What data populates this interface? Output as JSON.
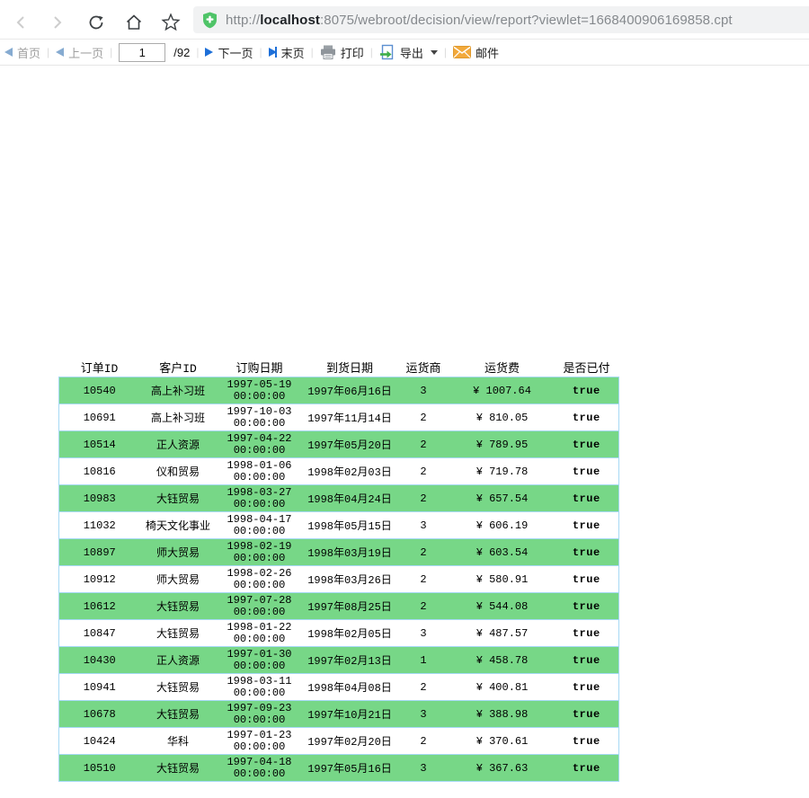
{
  "browser": {
    "url_scheme": "http://",
    "url_host": "localhost",
    "url_rest": ":8075/webroot/decision/view/report?viewlet=1668400906169858.cpt"
  },
  "toolbar": {
    "first_label": "首页",
    "prev_label": "上一页",
    "page_value": "1",
    "page_total": "/92",
    "next_label": "下一页",
    "last_label": "末页",
    "print_label": "打印",
    "export_label": "导出",
    "mail_label": "邮件"
  },
  "table": {
    "headers": [
      "订单ID",
      "客户ID",
      "订购日期",
      "到货日期",
      "运货商",
      "运货费",
      "是否已付"
    ],
    "rows": [
      {
        "order_id": "10540",
        "customer": "高上补习班",
        "order_date": "1997-05-19",
        "order_time": "00:00:00",
        "arrival_date": "1997年06月16日",
        "shipper": "3",
        "freight": "¥ 1007.64",
        "paid": "true"
      },
      {
        "order_id": "10691",
        "customer": "高上补习班",
        "order_date": "1997-10-03",
        "order_time": "00:00:00",
        "arrival_date": "1997年11月14日",
        "shipper": "2",
        "freight": "¥ 810.05",
        "paid": "true"
      },
      {
        "order_id": "10514",
        "customer": "正人资源",
        "order_date": "1997-04-22",
        "order_time": "00:00:00",
        "arrival_date": "1997年05月20日",
        "shipper": "2",
        "freight": "¥ 789.95",
        "paid": "true"
      },
      {
        "order_id": "10816",
        "customer": "仪和贸易",
        "order_date": "1998-01-06",
        "order_time": "00:00:00",
        "arrival_date": "1998年02月03日",
        "shipper": "2",
        "freight": "¥ 719.78",
        "paid": "true"
      },
      {
        "order_id": "10983",
        "customer": "大钰贸易",
        "order_date": "1998-03-27",
        "order_time": "00:00:00",
        "arrival_date": "1998年04月24日",
        "shipper": "2",
        "freight": "¥ 657.54",
        "paid": "true"
      },
      {
        "order_id": "11032",
        "customer": "椅天文化事业",
        "order_date": "1998-04-17",
        "order_time": "00:00:00",
        "arrival_date": "1998年05月15日",
        "shipper": "3",
        "freight": "¥ 606.19",
        "paid": "true"
      },
      {
        "order_id": "10897",
        "customer": "师大贸易",
        "order_date": "1998-02-19",
        "order_time": "00:00:00",
        "arrival_date": "1998年03月19日",
        "shipper": "2",
        "freight": "¥ 603.54",
        "paid": "true"
      },
      {
        "order_id": "10912",
        "customer": "师大贸易",
        "order_date": "1998-02-26",
        "order_time": "00:00:00",
        "arrival_date": "1998年03月26日",
        "shipper": "2",
        "freight": "¥ 580.91",
        "paid": "true"
      },
      {
        "order_id": "10612",
        "customer": "大钰贸易",
        "order_date": "1997-07-28",
        "order_time": "00:00:00",
        "arrival_date": "1997年08月25日",
        "shipper": "2",
        "freight": "¥ 544.08",
        "paid": "true"
      },
      {
        "order_id": "10847",
        "customer": "大钰贸易",
        "order_date": "1998-01-22",
        "order_time": "00:00:00",
        "arrival_date": "1998年02月05日",
        "shipper": "3",
        "freight": "¥ 487.57",
        "paid": "true"
      },
      {
        "order_id": "10430",
        "customer": "正人资源",
        "order_date": "1997-01-30",
        "order_time": "00:00:00",
        "arrival_date": "1997年02月13日",
        "shipper": "1",
        "freight": "¥ 458.78",
        "paid": "true"
      },
      {
        "order_id": "10941",
        "customer": "大钰贸易",
        "order_date": "1998-03-11",
        "order_time": "00:00:00",
        "arrival_date": "1998年04月08日",
        "shipper": "2",
        "freight": "¥ 400.81",
        "paid": "true"
      },
      {
        "order_id": "10678",
        "customer": "大钰贸易",
        "order_date": "1997-09-23",
        "order_time": "00:00:00",
        "arrival_date": "1997年10月21日",
        "shipper": "3",
        "freight": "¥ 388.98",
        "paid": "true"
      },
      {
        "order_id": "10424",
        "customer": "华科",
        "order_date": "1997-01-23",
        "order_time": "00:00:00",
        "arrival_date": "1997年02月20日",
        "shipper": "2",
        "freight": "¥ 370.61",
        "paid": "true"
      },
      {
        "order_id": "10510",
        "customer": "大钰贸易",
        "order_date": "1997-04-18",
        "order_time": "00:00:00",
        "arrival_date": "1997年05月16日",
        "shipper": "3",
        "freight": "¥ 367.63",
        "paid": "true"
      }
    ]
  },
  "colors": {
    "row_green": "#77d787",
    "grid_blue": "#a6d9f5",
    "freight_red": "#f4503c",
    "link_blue": "#1d6fd8"
  }
}
